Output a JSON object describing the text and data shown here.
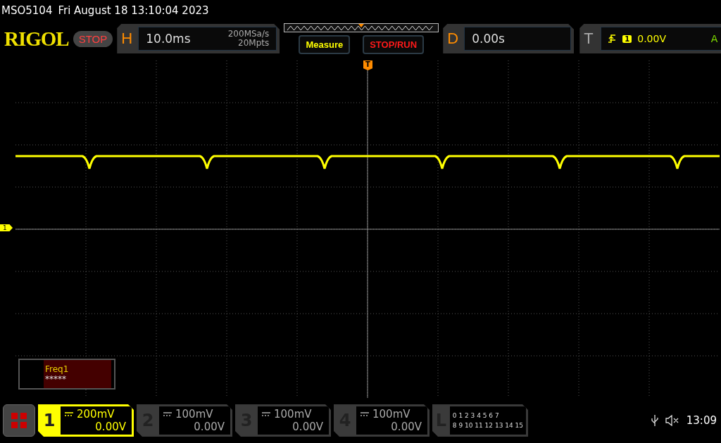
{
  "status_line": {
    "model": "MSO5104",
    "datetime": "Fri August 18 13:10:04 2023"
  },
  "logo": "RIGOL",
  "run_state": "STOP",
  "horizontal": {
    "label": "H",
    "timebase": "10.0ms",
    "sample_rate": "200MSa/s",
    "memory_depth": "20Mpts"
  },
  "buttons": [
    {
      "label": "Measure",
      "color": "#ffff00"
    },
    {
      "label": "STOP/RUN",
      "color": "#ff1a1a"
    }
  ],
  "delay": {
    "label": "D",
    "value": "0.00s"
  },
  "trigger": {
    "label": "T",
    "source": "1",
    "level": "0.00V",
    "mode": "A"
  },
  "trigger_marker": "T",
  "channel_marker": "1",
  "measurement": {
    "name": "Freq1",
    "value": "*****"
  },
  "channels": [
    {
      "number": "1",
      "scale": "200mV",
      "offset": "0.00V",
      "selected": true
    },
    {
      "number": "2",
      "scale": "100mV",
      "offset": "0.00V",
      "selected": false
    },
    {
      "number": "3",
      "scale": "100mV",
      "offset": "0.00V",
      "selected": false
    },
    {
      "number": "4",
      "scale": "100mV",
      "offset": "0.00V",
      "selected": false
    }
  ],
  "logic": {
    "label": "L",
    "rows": [
      "0 1 2 3  4 5 6 7",
      "8 9 10 11 12 13 14 15"
    ]
  },
  "clock": "13:09"
}
